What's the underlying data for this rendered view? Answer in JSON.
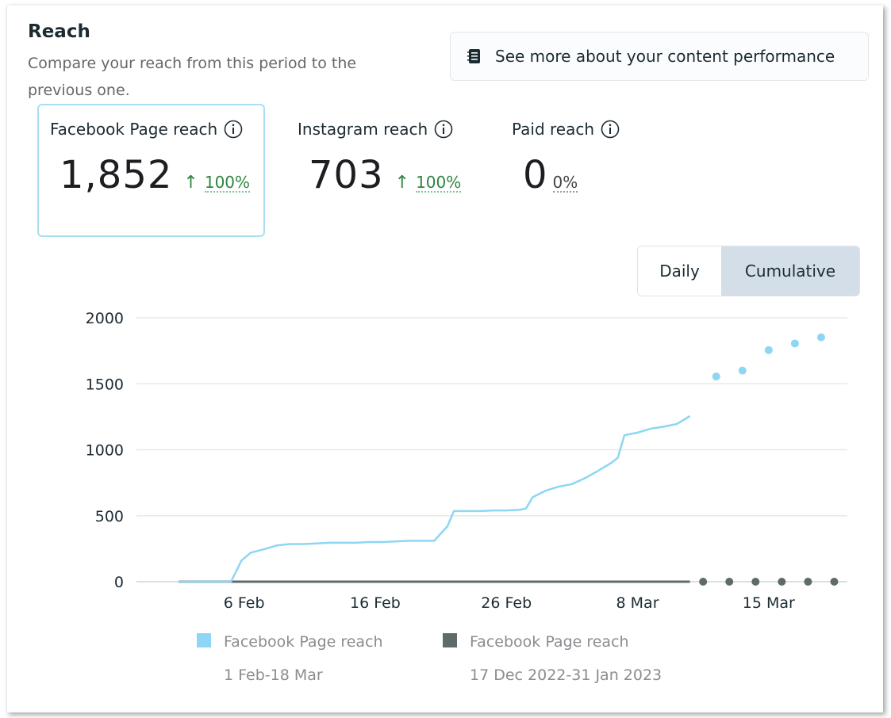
{
  "header": {
    "title": "Reach",
    "subtitle": "Compare your reach from this period to the previous one.",
    "more_button": "See more about your content performance"
  },
  "metrics": [
    {
      "label": "Facebook Page reach",
      "value": "1,852",
      "change": "100%",
      "trend": "up",
      "selected": true
    },
    {
      "label": "Instagram reach",
      "value": "703",
      "change": "100%",
      "trend": "up",
      "selected": false
    },
    {
      "label": "Paid reach",
      "value": "0",
      "change": "0%",
      "trend": "none",
      "selected": false
    }
  ],
  "toggle": {
    "options": [
      "Daily",
      "Cumulative"
    ],
    "selected": "Cumulative"
  },
  "colors": {
    "current": "#8dd6f4",
    "previous": "#5f6b6b",
    "up": "#2e8540"
  },
  "chart_data": {
    "type": "line",
    "ylim": [
      0,
      2000
    ],
    "y_ticks": [
      0,
      500,
      1000,
      1500,
      2000
    ],
    "x_ticks": [
      {
        "label": "6 Feb",
        "day": 6
      },
      {
        "label": "16 Feb",
        "day": 16
      },
      {
        "label": "26 Feb",
        "day": 26
      },
      {
        "label": "8 Mar",
        "day": 36
      },
      {
        "label": "15 Mar",
        "day": 46
      }
    ],
    "x_domain": [
      1,
      52
    ],
    "grid": true,
    "series": [
      {
        "name": "Facebook Page reach",
        "period": "1 Feb-18 Mar",
        "color": "#8dd6f4",
        "style": "solid",
        "points": [
          [
            1,
            0
          ],
          [
            2,
            0
          ],
          [
            3,
            0
          ],
          [
            4,
            0
          ],
          [
            5,
            0
          ],
          [
            5.8,
            160
          ],
          [
            6.5,
            220
          ],
          [
            7.5,
            245
          ],
          [
            8.5,
            275
          ],
          [
            9.5,
            285
          ],
          [
            10.5,
            285
          ],
          [
            11.5,
            290
          ],
          [
            12.5,
            295
          ],
          [
            13.5,
            295
          ],
          [
            14.5,
            295
          ],
          [
            15.5,
            300
          ],
          [
            16.5,
            300
          ],
          [
            17.5,
            305
          ],
          [
            18.5,
            310
          ],
          [
            19.5,
            310
          ],
          [
            20.5,
            310
          ],
          [
            21.5,
            420
          ],
          [
            22,
            535
          ],
          [
            23,
            535
          ],
          [
            24,
            535
          ],
          [
            25,
            540
          ],
          [
            26,
            540
          ],
          [
            27,
            545
          ],
          [
            27.5,
            555
          ],
          [
            28,
            640
          ],
          [
            29,
            690
          ],
          [
            30,
            720
          ],
          [
            31,
            740
          ],
          [
            32,
            785
          ],
          [
            33,
            840
          ],
          [
            34,
            900
          ],
          [
            34.5,
            940
          ],
          [
            35,
            1110
          ],
          [
            36,
            1130
          ],
          [
            37,
            1160
          ],
          [
            38,
            1175
          ],
          [
            39,
            1195
          ],
          [
            40,
            1255
          ]
        ],
        "dotted_points": [
          [
            42,
            1555
          ],
          [
            44,
            1600
          ],
          [
            46,
            1755
          ],
          [
            48,
            1805
          ],
          [
            50,
            1852
          ]
        ]
      },
      {
        "name": "Facebook Page reach",
        "period": "17 Dec 2022-31 Jan 2023",
        "color": "#5f6b6b",
        "style": "solid",
        "points": [
          [
            1,
            0
          ],
          [
            40,
            0
          ]
        ],
        "dotted_points": [
          [
            41,
            0
          ],
          [
            43,
            0
          ],
          [
            45,
            0
          ],
          [
            47,
            0
          ],
          [
            49,
            0
          ],
          [
            51,
            0
          ]
        ]
      }
    ]
  }
}
